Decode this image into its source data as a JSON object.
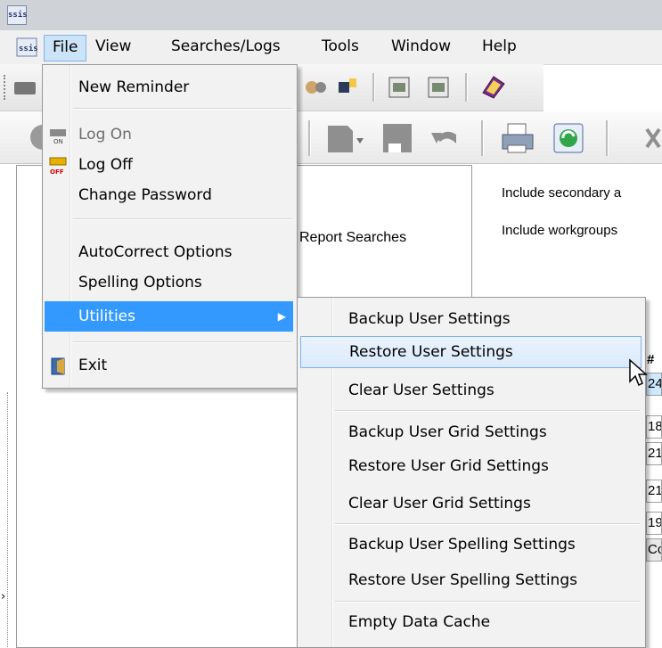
{
  "app": {
    "logo_text": "ssis"
  },
  "menubar": {
    "items": [
      {
        "label": "File"
      },
      {
        "label": "View"
      },
      {
        "label": "Searches/Logs"
      },
      {
        "label": "Tools"
      },
      {
        "label": "Window"
      },
      {
        "label": "Help"
      }
    ]
  },
  "file_menu": {
    "items": [
      {
        "label": "New Reminder"
      },
      {
        "label": "Log On",
        "disabled": true,
        "icon": "log-on-key-icon"
      },
      {
        "label": "Log Off",
        "icon": "log-off-key-icon"
      },
      {
        "label": "Change Password"
      },
      {
        "label": "AutoCorrect Options"
      },
      {
        "label": "Spelling Options"
      },
      {
        "label": "Utilities",
        "selected": true
      },
      {
        "label": "Exit",
        "icon": "exit-door-icon"
      }
    ]
  },
  "utilities_menu": {
    "items": [
      {
        "label": "Backup User Settings"
      },
      {
        "label": "Restore User Settings",
        "hover": true
      },
      {
        "label": "Clear User Settings"
      },
      {
        "label": "Backup User Grid Settings"
      },
      {
        "label": "Restore User Grid Settings"
      },
      {
        "label": "Clear User Grid Settings"
      },
      {
        "label": "Backup User Spelling Settings"
      },
      {
        "label": "Restore User Spelling Settings"
      },
      {
        "label": "Empty Data Cache"
      }
    ]
  },
  "background": {
    "report_searches": "Report Searches",
    "include_secondary": "Include secondary a",
    "include_workgroups": "Include workgroups",
    "grid_header": "#",
    "grid_cells": [
      "24",
      "18",
      "21",
      "21",
      "19",
      "Co"
    ]
  },
  "colors": {
    "selection_blue": "#3399ff",
    "hover_border": "#7eb4ea",
    "menu_bg": "#f2f2f2"
  }
}
